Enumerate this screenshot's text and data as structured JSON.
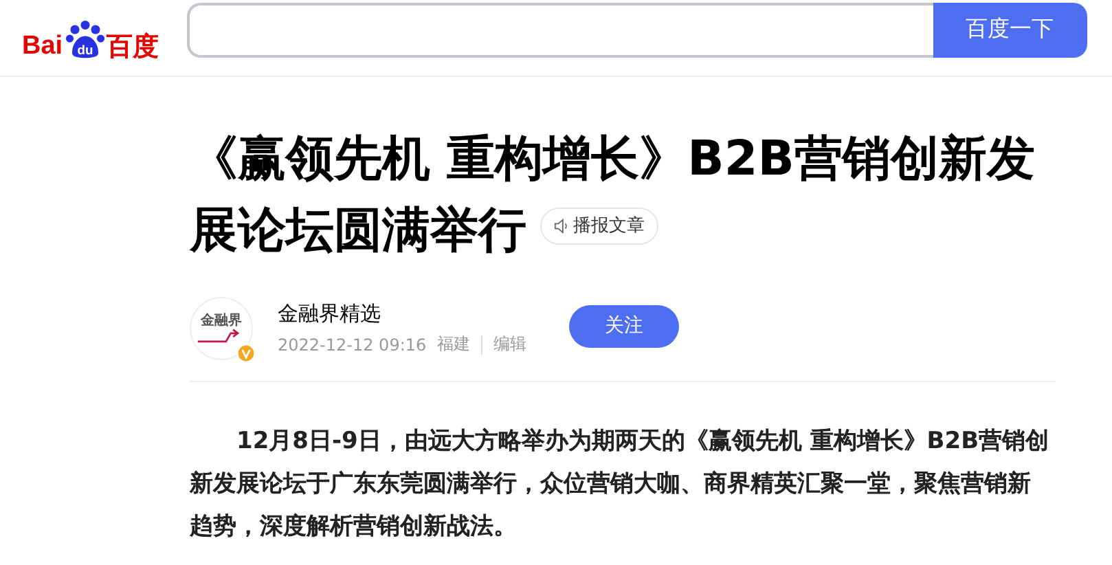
{
  "header": {
    "logo": {
      "left": "Bai",
      "paw": "du",
      "right": "百度"
    },
    "search": {
      "button": "百度一下"
    }
  },
  "article": {
    "title_lines": [
      "《赢领先机 重构增长》B2B营销创新发",
      "展论坛圆满举行"
    ],
    "listen": "播报文章",
    "author": {
      "avatar_text": "金融界",
      "name": "金融界精选",
      "verified": true,
      "date": "2022-12-12 09:16",
      "location": "福建",
      "edit": "编辑",
      "follow": "关注"
    },
    "body": [
      "12月8日-9日，由远大方略举办为期两天的《赢领先机 重构增长》B2B营销创新发展论坛于广东东莞圆满举行，众位营销大咖、商界精英汇聚一堂，聚焦营销新趋势，深度解析营销创新战法。"
    ]
  }
}
